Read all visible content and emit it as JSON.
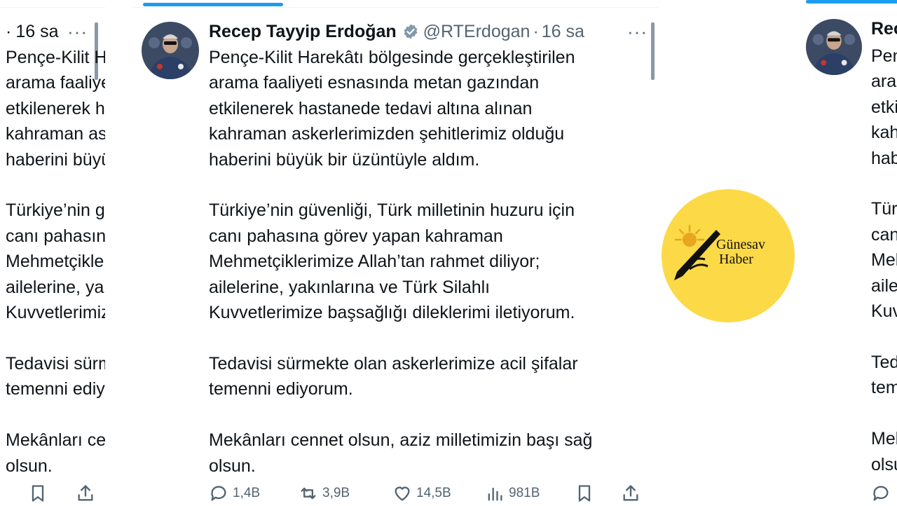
{
  "tweet": {
    "author_name": "Recep Tayyip Erdoğan",
    "handle": "@RTErdogan",
    "separator": "·",
    "time": "16 sa",
    "more": "···",
    "text": "Pençe-Kilit Harekâtı bölgesinde gerçekleştirilen\narama faaliyeti esnasında metan gazından\netkilenerek hastanede tedavi altına alınan\nkahraman askerlerimizden şehitlerimiz olduğu\nhaberini büyük bir üzüntüyle aldım.\n\nTürkiye’nin güvenliği, Türk milletinin huzuru için\ncanı pahasına görev yapan kahraman\nMehmetçiklerimize Allah’tan rahmet diliyor;\nailelerine, yakınlarına ve Türk Silahlı\nKuvvetlerimize başsağlığı dileklerimi iletiyorum.\n\nTedavisi sürmekte olan askerlerimize acil şifalar\ntemenni ediyorum.\n\nMekânları cennet olsun, aziz milletimizin başı sağ\nolsun.",
    "actions": {
      "replies": "1,4B",
      "retweets": "3,9B",
      "likes": "14,5B",
      "views": "981B"
    }
  },
  "logo": {
    "line1": "Günesav",
    "line2": "Haber",
    "color": "#fcd947"
  },
  "colors": {
    "accent": "#1d9bf0",
    "secondary_text": "#536471",
    "primary_text": "#0f1419"
  },
  "icons": [
    "verified-badge-icon",
    "more-icon",
    "reply-icon",
    "retweet-icon",
    "like-icon",
    "views-icon",
    "bookmark-icon",
    "share-icon"
  ]
}
